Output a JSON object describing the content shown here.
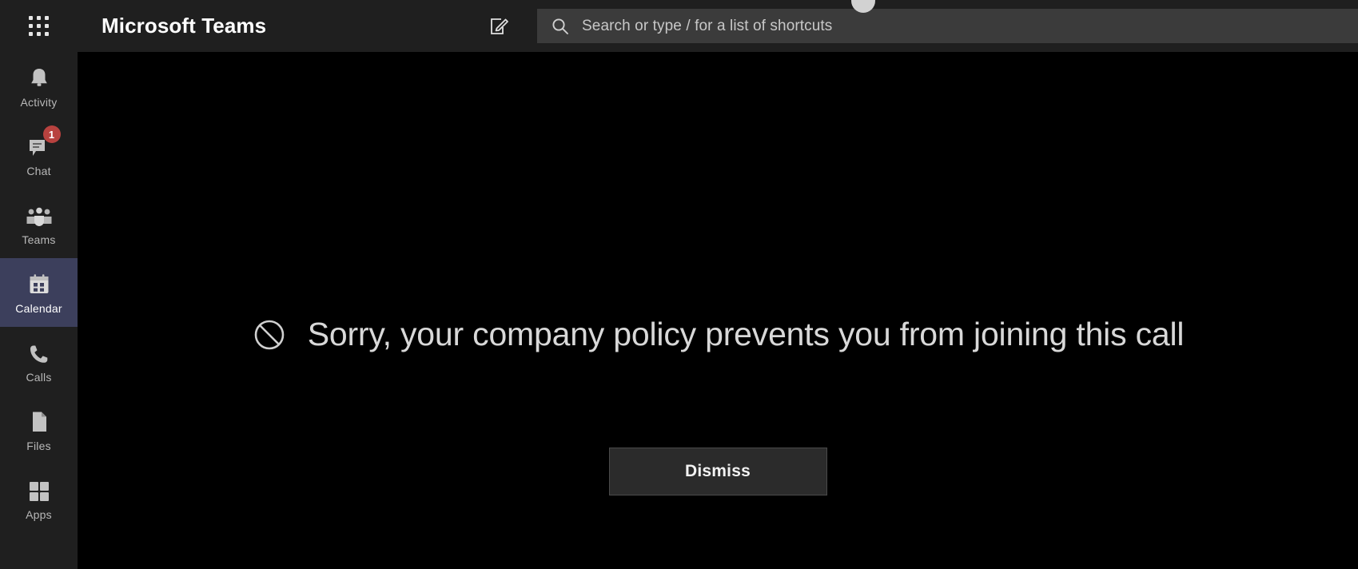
{
  "header": {
    "app_grid_icon": "app-grid-icon",
    "title": "Microsoft Teams",
    "compose_icon": "compose-new-chat-icon",
    "search": {
      "icon": "search-icon",
      "placeholder": "Search or type / for a list of shortcuts",
      "value": ""
    },
    "avatar_icon": "user-avatar-icon"
  },
  "sidebar": {
    "items": [
      {
        "label": "Activity",
        "icon": "bell-icon",
        "active": false,
        "badge": ""
      },
      {
        "label": "Chat",
        "icon": "chat-bubble-icon",
        "active": false,
        "badge": "1"
      },
      {
        "label": "Teams",
        "icon": "people-icon",
        "active": false,
        "badge": ""
      },
      {
        "label": "Calendar",
        "icon": "calendar-icon",
        "active": true,
        "badge": ""
      },
      {
        "label": "Calls",
        "icon": "phone-icon",
        "active": false,
        "badge": ""
      },
      {
        "label": "Files",
        "icon": "file-icon",
        "active": false,
        "badge": ""
      },
      {
        "label": "Apps",
        "icon": "apps-grid-icon",
        "active": false,
        "badge": ""
      }
    ]
  },
  "main": {
    "notice": {
      "icon": "prohibited-icon",
      "message": "Sorry, your company policy prevents you from joining this call"
    },
    "dismiss_label": "Dismiss"
  },
  "colors": {
    "chrome": "#1f1f1f",
    "stage": "#000000",
    "search_field": "#3b3b3b",
    "active_item": "#3c3f5c",
    "badge": "#b8423f",
    "button_fill": "#2b2b2b",
    "button_border": "#4a4a4a",
    "text_primary": "#ffffff",
    "text_muted": "#b8b8b8",
    "notice_text": "#d8d8d8"
  }
}
